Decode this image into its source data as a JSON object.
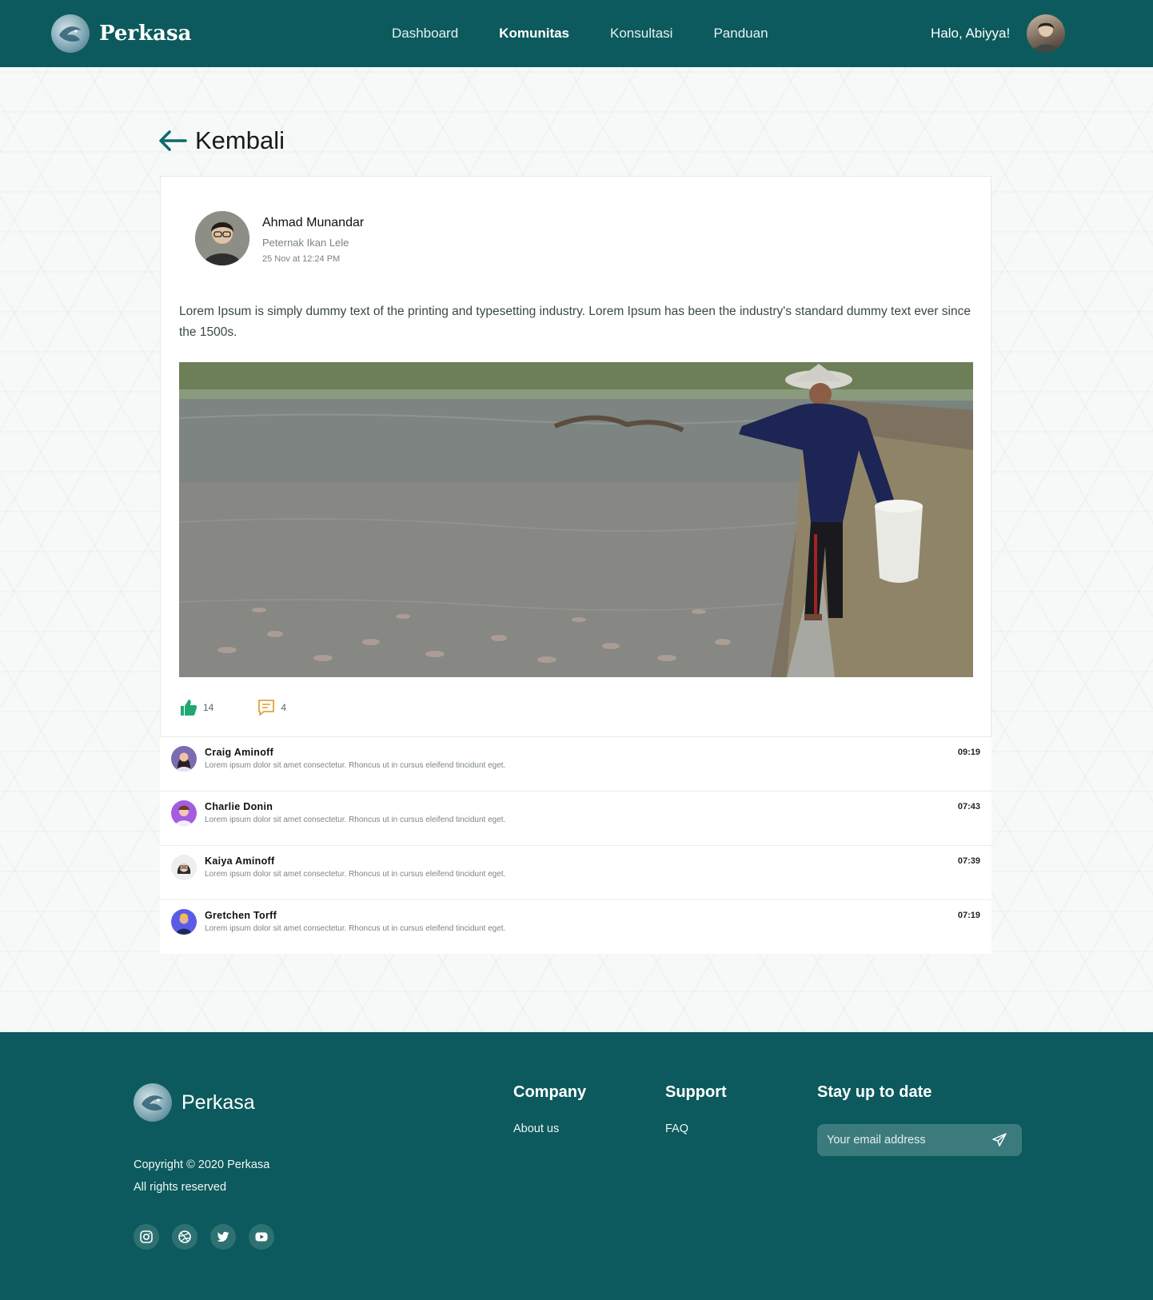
{
  "nav": {
    "brand": "Perkasa",
    "links": [
      "Dashboard",
      "Komunitas",
      "Konsultasi",
      "Panduan"
    ],
    "active_link": "Komunitas",
    "greeting": "Halo, Abiyya!"
  },
  "back_label": "Kembali",
  "post": {
    "author_name": "Ahmad Munandar",
    "author_role": "Peternak Ikan Lele",
    "date": "25 Nov at 12:24 PM",
    "text": "Lorem Ipsum is simply dummy text of the printing and typesetting industry. Lorem Ipsum has been the industry's standard dummy text ever since the 1500s.",
    "likes": "14",
    "comments_count": "4"
  },
  "comments": [
    {
      "name": "Craig Aminoff",
      "text": "Lorem ipsum dolor sit amet consectetur. Rhoncus ut in cursus eleifend tincidunt eget.",
      "time": "09:19"
    },
    {
      "name": "Charlie Donin",
      "text": "Lorem ipsum dolor sit amet consectetur. Rhoncus ut in cursus eleifend tincidunt eget.",
      "time": "07:43"
    },
    {
      "name": "Kaiya Aminoff",
      "text": "Lorem ipsum dolor sit amet consectetur. Rhoncus ut in cursus eleifend tincidunt eget.",
      "time": "07:39"
    },
    {
      "name": "Gretchen Torff",
      "text": "Lorem ipsum dolor sit amet consectetur. Rhoncus ut in cursus eleifend tincidunt eget.",
      "time": "07:19"
    }
  ],
  "footer": {
    "brand": "Perkasa",
    "copyright": "Copyright © 2020 Perkasa",
    "rights": "All rights reserved",
    "company_heading": "Company",
    "company_link": "About us",
    "support_heading": "Support",
    "support_link": "FAQ",
    "newsletter_heading": "Stay up to date",
    "email_placeholder": "Your email address",
    "socials": [
      "instagram-icon",
      "dribbble-icon",
      "twitter-icon",
      "youtube-icon"
    ]
  },
  "colors": {
    "primary": "#0c5a5d",
    "like": "#1fa971",
    "comment_icon": "#e0a43a"
  }
}
